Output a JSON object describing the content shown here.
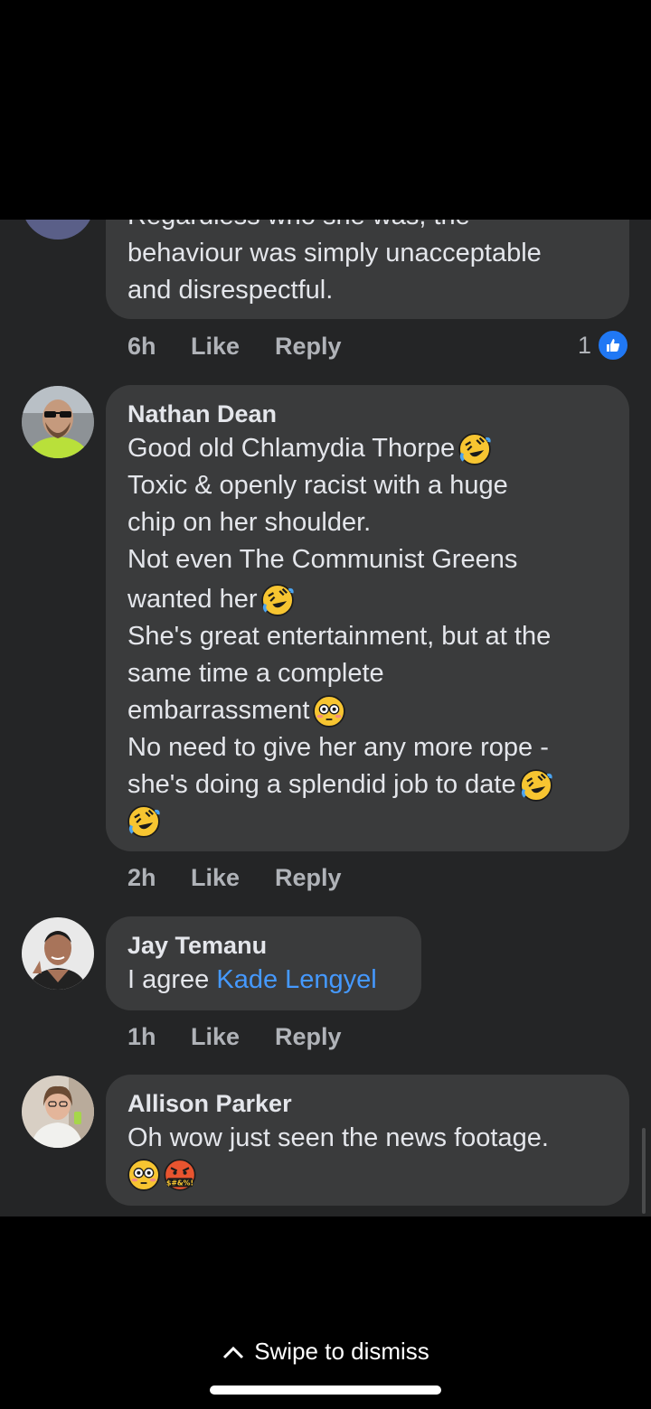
{
  "comments": [
    {
      "name": "",
      "lines": [
        "Regardless who she was, the",
        "behaviour was simply unacceptable",
        "and disrespectful."
      ],
      "time": "6h",
      "like_label": "Like",
      "reply_label": "Reply",
      "reaction_count": "1"
    },
    {
      "name": "Nathan Dean",
      "lines": [
        "Good old Chlamydia Thorpe",
        "Toxic & openly racist with a huge",
        "chip on her shoulder.",
        "Not even The Communist Greens",
        "wanted her",
        "She's great entertainment, but at the",
        "same time a complete",
        "embarrassment",
        "No need to give her any more rope -",
        "she's doing a splendid job to date"
      ],
      "time": "2h",
      "like_label": "Like",
      "reply_label": "Reply"
    },
    {
      "name": "Jay Temanu",
      "text": "I agree",
      "mention": "Kade Lengyel",
      "time": "1h",
      "like_label": "Like",
      "reply_label": "Reply"
    },
    {
      "name": "Allison Parker",
      "lines": [
        "Oh wow just seen the news footage."
      ],
      "symbol_text": "$#&%!"
    }
  ],
  "footer": {
    "swipe_label": "Swipe to dismiss"
  },
  "colors": {
    "background": "#242526",
    "bubble": "#3a3b3c",
    "link": "#4599ff",
    "like_blue": "#2078f4"
  }
}
